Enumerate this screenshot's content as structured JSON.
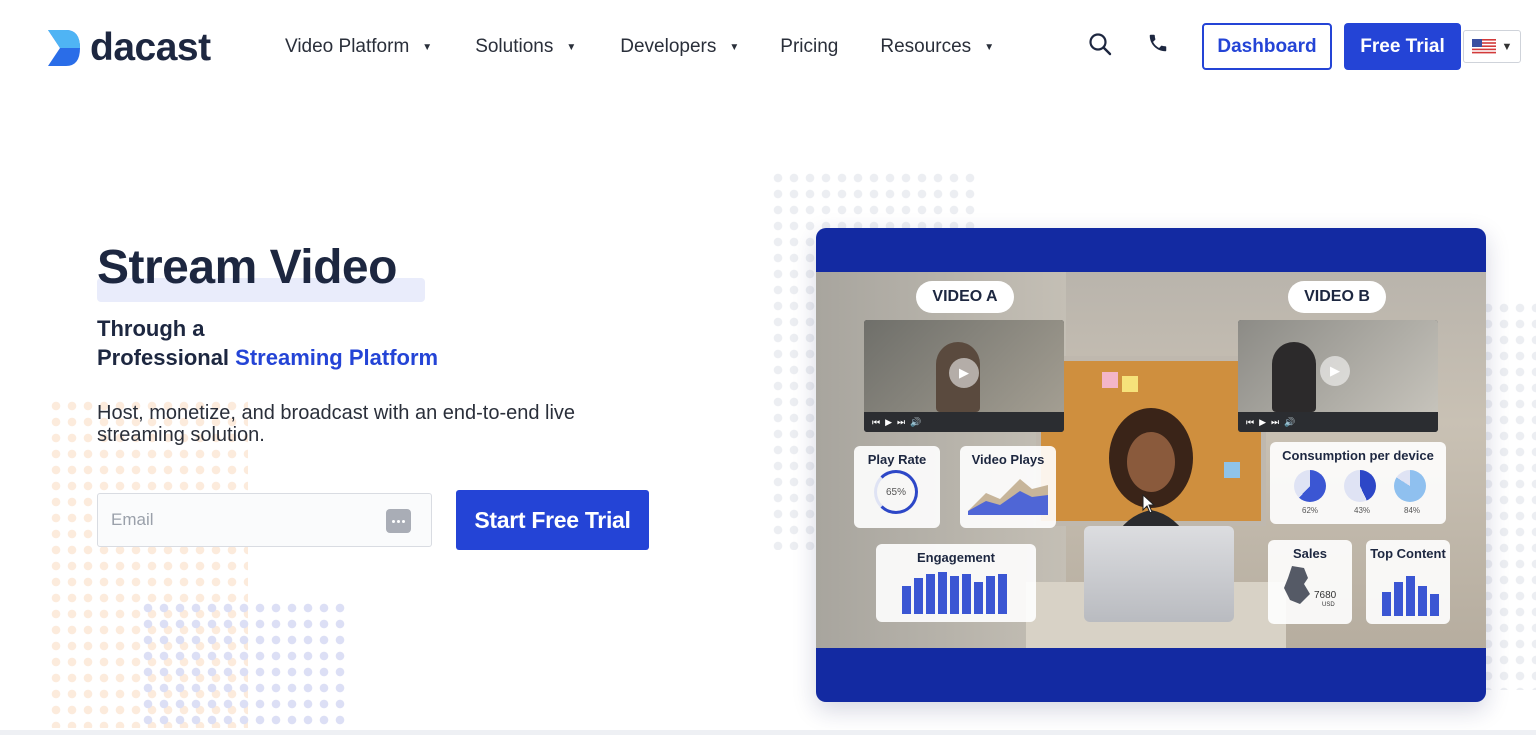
{
  "brand": {
    "name": "dacast"
  },
  "nav": {
    "items": [
      {
        "label": "Video Platform",
        "has_dropdown": true
      },
      {
        "label": "Solutions",
        "has_dropdown": true
      },
      {
        "label": "Developers",
        "has_dropdown": true
      },
      {
        "label": "Pricing",
        "has_dropdown": false
      },
      {
        "label": "Resources",
        "has_dropdown": true
      }
    ],
    "dashboard_label": "Dashboard",
    "free_trial_label": "Free Trial",
    "language": {
      "icon": "us-flag-icon"
    }
  },
  "hero": {
    "title": "Stream Video",
    "subtitle_line1": "Through a",
    "subtitle_line2_prefix": "Professional ",
    "subtitle_line2_accent": "Streaming Platform",
    "description": "Host, monetize, and broadcast with an end-to-end live streaming solution.",
    "email": {
      "placeholder": "Email",
      "value": ""
    },
    "cta_label": "Start Free Trial"
  },
  "mockup": {
    "video_a_label": "VIDEO A",
    "video_b_label": "VIDEO B",
    "cards": {
      "play_rate": {
        "title": "Play Rate",
        "value": "65%"
      },
      "video_plays": {
        "title": "Video Plays"
      },
      "engagement": {
        "title": "Engagement"
      },
      "consumption": {
        "title": "Consumption per device",
        "values": [
          "62%",
          "43%",
          "84%"
        ]
      },
      "sales": {
        "title": "Sales",
        "value": "7680",
        "unit": "USD"
      },
      "top_content": {
        "title": "Top Content"
      }
    }
  },
  "colors": {
    "accent": "#2444d6",
    "heading": "#1d2740",
    "frame": "#132aa2"
  }
}
